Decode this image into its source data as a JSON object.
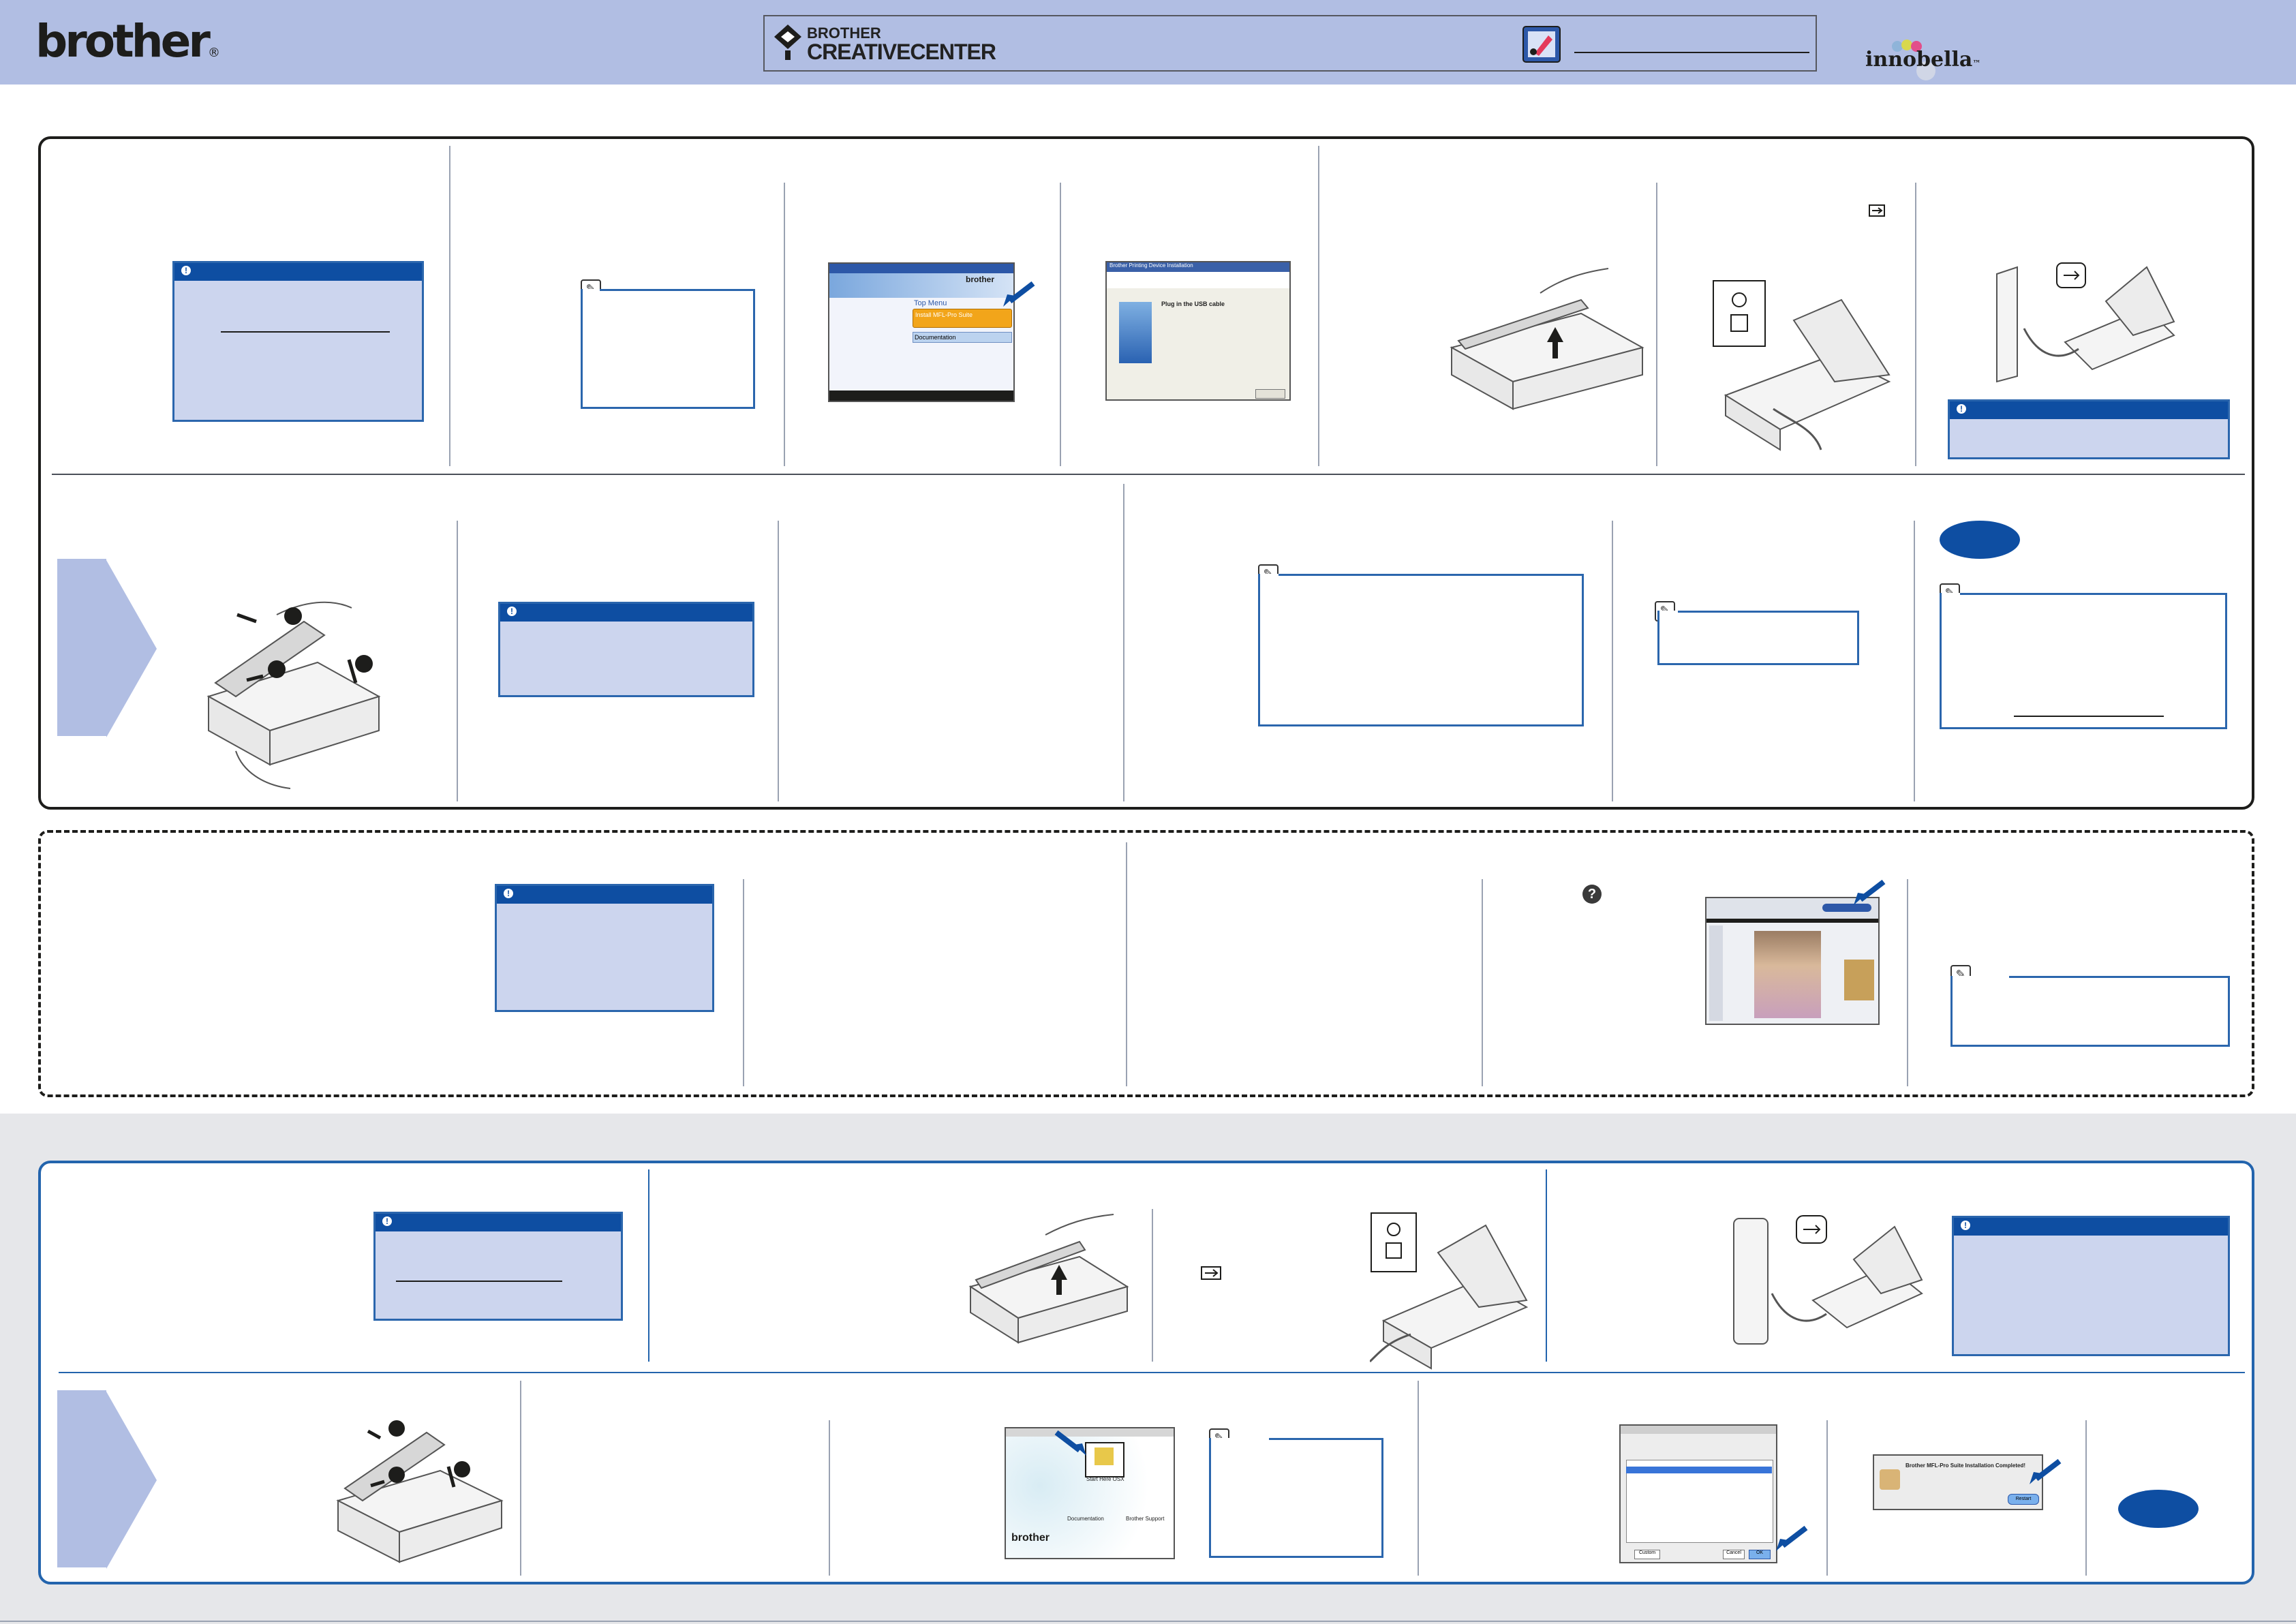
{
  "header": {
    "brand": "brother",
    "brand_mark": "®",
    "creative_center_line1": "BROTHER",
    "creative_center_line2": "CREATIVECENTER",
    "product_logo": "innobella",
    "product_logo_tm": "™",
    "header_bg": "#b1bee3"
  },
  "windows_installer": {
    "top_menu_label": "Top Menu",
    "install_button": "Install MFL-Pro Suite",
    "documentation_button": "Documentation",
    "brand": "brother"
  },
  "usb_dialog": {
    "title": "Brother Printing Device Installation",
    "heading": "Plug in the USB cable"
  },
  "mac_dialogs": {
    "installer_brand": "brother",
    "install_label": "Start Here OSX",
    "documentation_label": "Documentation",
    "support_label": "Brother Support",
    "completed_title": "Brother MFL-Pro Suite Installation Completed!",
    "restart_button": "Restart",
    "ok_button": "OK",
    "cancel_button": "Cancel",
    "custom_button": "Custom"
  },
  "icons": [
    "caution-icon",
    "note-pen-icon",
    "usb-icon",
    "help-icon",
    "arrow-icon"
  ],
  "colors": {
    "accent": "#0e4ea2",
    "caution_fill": "#ccd5ee",
    "caution_border": "#2b66ad",
    "mac_frame": "#2364ad",
    "gray_band": "#e6e7ea"
  }
}
